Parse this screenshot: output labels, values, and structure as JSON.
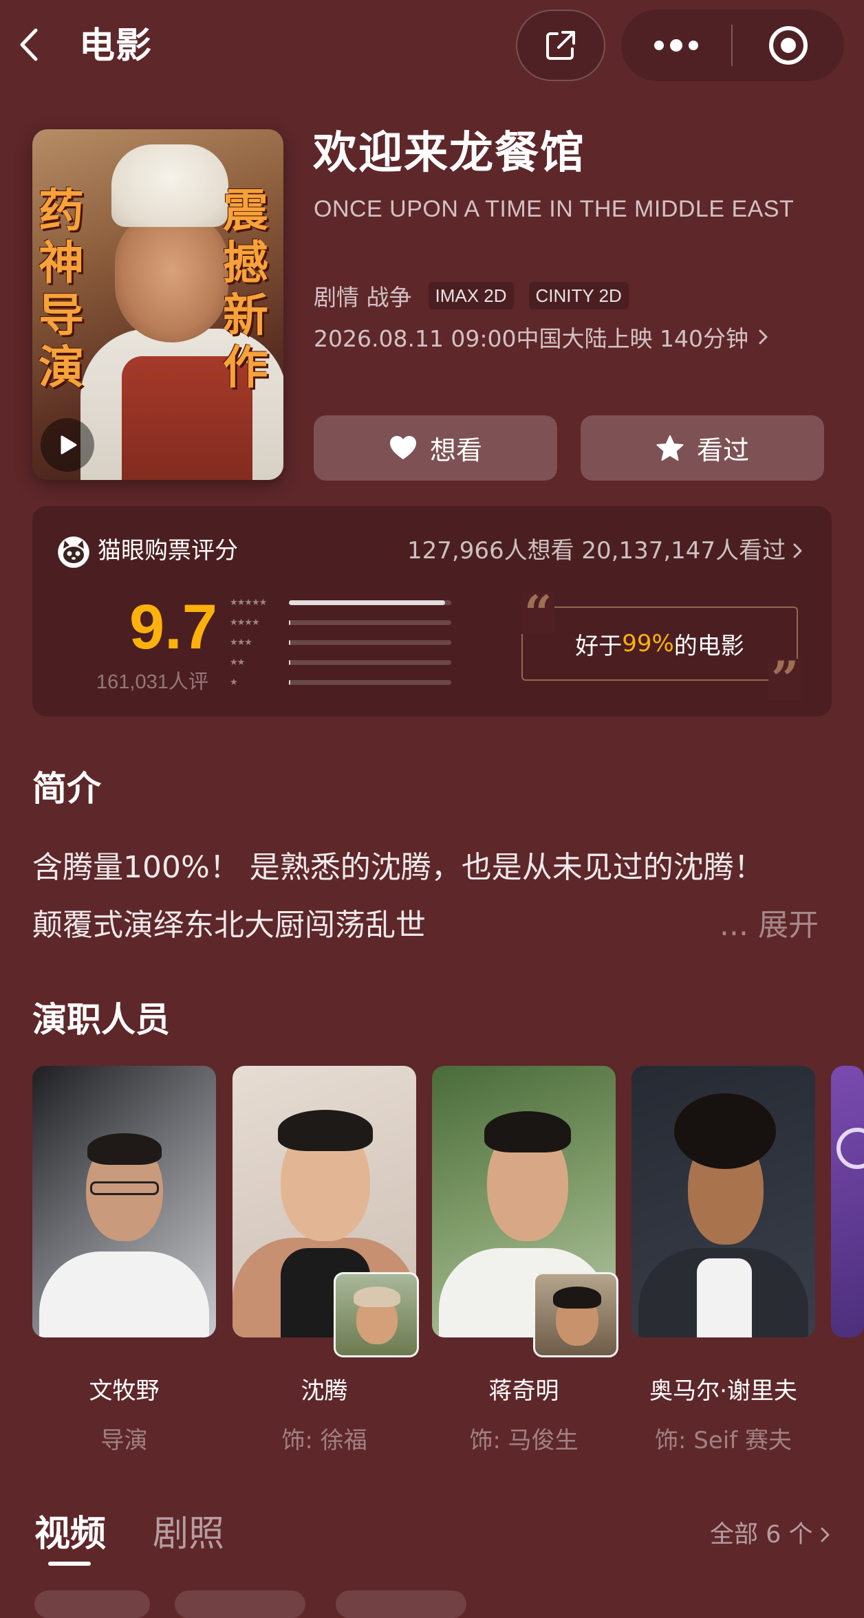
{
  "header": {
    "title": "电影"
  },
  "movie": {
    "title": "欢迎来龙餐馆",
    "english_title": "ONCE UPON A TIME IN THE MIDDLE EAST",
    "genre": "剧情 战争",
    "tags": [
      "IMAX 2D",
      "CINITY 2D"
    ],
    "release": "2026.08.11 09:00中国大陆上映 140分钟",
    "poster": {
      "left_text": "药神导演",
      "right_text": "震撼新作"
    }
  },
  "actions": {
    "want": "想看",
    "watched": "看过"
  },
  "rating": {
    "label": "猫眼购票评分",
    "counts": "127,966人想看 20,137,147人看过",
    "score": "9.7",
    "count": "161,031人评",
    "distribution": [
      {
        "stars": "★★★★★",
        "fraction": 0.96
      },
      {
        "stars": "★★★★",
        "fraction": 0.01
      },
      {
        "stars": "★★★",
        "fraction": 0.01
      },
      {
        "stars": "★★",
        "fraction": 0.01
      },
      {
        "stars": "★",
        "fraction": 0.01
      }
    ],
    "better_prefix": "好于",
    "better_value": "99%",
    "better_suffix": "的电影"
  },
  "intro": {
    "title": "简介",
    "line1": "含腾量100%！ 是熟悉的沈腾，也是从未见过的沈腾！",
    "line2": "颠覆式演绎东北大厨闯荡乱世",
    "expand": "... 展开"
  },
  "cast": {
    "title": "演职人员",
    "members": [
      {
        "name": "文牧野",
        "role": "导演"
      },
      {
        "name": "沈腾",
        "role": "饰: 徐福"
      },
      {
        "name": "蒋奇明",
        "role": "饰: 马俊生"
      },
      {
        "name": "奥马尔·谢里夫",
        "role": "饰: Seif 赛夫"
      }
    ]
  },
  "media": {
    "tab_video": "视频",
    "tab_photos": "剧照",
    "view_all": "全部 6 个"
  },
  "colors": {
    "background": "#5e272a",
    "score": "#fdb10c",
    "accent": "#f7a23a"
  },
  "icons": [
    "back-icon",
    "share-icon",
    "more-icon",
    "target-icon",
    "play-icon",
    "heart-icon",
    "star-icon",
    "cat-logo-icon",
    "chevron-right-icon"
  ]
}
